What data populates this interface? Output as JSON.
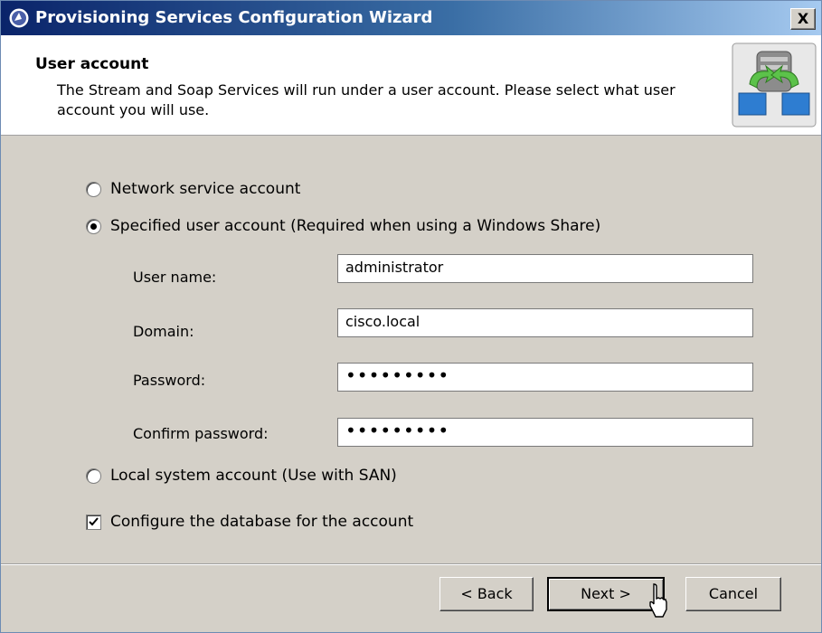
{
  "window": {
    "title": "Provisioning Services Configuration Wizard",
    "close_label": "X"
  },
  "header": {
    "title": "User account",
    "description": "The Stream and Soap Services will run under a user account. Please select what user account you will use."
  },
  "options": {
    "network_service": {
      "label": "Network service account",
      "selected": false
    },
    "specified_user": {
      "label": "Specified user account  (Required when using a Windows Share)",
      "selected": true
    },
    "local_system": {
      "label": "Local system account  (Use with SAN)",
      "selected": false
    },
    "configure_db": {
      "label": "Configure the database for the account",
      "checked": true
    }
  },
  "fields": {
    "username": {
      "label": "User name:",
      "value": "administrator"
    },
    "domain": {
      "label": "Domain:",
      "value": "cisco.local"
    },
    "password": {
      "label": "Password:",
      "value": "•••••••••"
    },
    "confirm": {
      "label": "Confirm password:",
      "value": "•••••••••"
    }
  },
  "buttons": {
    "back": "< Back",
    "next": "Next >",
    "cancel": "Cancel"
  },
  "colors": {
    "titlebar_start": "#0a246a",
    "titlebar_end": "#a6caf0",
    "dialog_bg": "#d4d0c8"
  }
}
